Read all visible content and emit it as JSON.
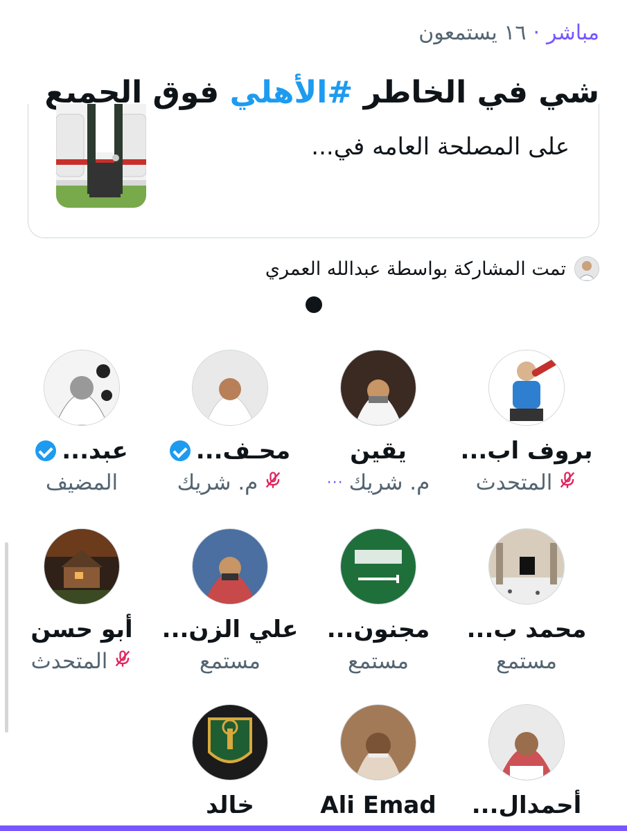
{
  "header": {
    "live_label": "مباشر",
    "separator": "·",
    "listeners": "١٦ يستمعون",
    "title_part1": "شي في الخاطر",
    "title_hashtag": "#الأهلي",
    "title_part2": "فوق الجميع"
  },
  "card": {
    "text": "على المصلحة العامه في..."
  },
  "shared_by": {
    "text": "تمت المشاركة بواسطة عبدالله العمري"
  },
  "participants": [
    {
      "name": "بروف اب...",
      "role": "المتحدث",
      "muted": true,
      "verified": false,
      "avatar_icon": "plumber-avatar"
    },
    {
      "name": "يقين",
      "role": "م. شريك",
      "muted": false,
      "more": "···",
      "verified": false,
      "avatar_icon": "man-shemagh-avatar"
    },
    {
      "name": "محـف...",
      "role": "م. شريك",
      "muted": true,
      "verified": true,
      "avatar_icon": "man-white-ghutra-avatar"
    },
    {
      "name": "عبد...",
      "role": "المضيف",
      "muted": false,
      "verified": true,
      "avatar_icon": "man-bw-avatar"
    },
    {
      "name": "محمد ب...",
      "role": "مستمع",
      "muted": false,
      "verified": false,
      "avatar_icon": "mosque-avatar"
    },
    {
      "name": "مجنون...",
      "role": "مستمع",
      "muted": false,
      "verified": false,
      "avatar_icon": "saudi-flag-avatar"
    },
    {
      "name": "علي الزن...",
      "role": "مستمع",
      "muted": false,
      "verified": false,
      "avatar_icon": "man-red-shemagh-avatar"
    },
    {
      "name": "أبو حسن",
      "role": "المتحدث",
      "muted": true,
      "verified": false,
      "avatar_icon": "cabin-avatar"
    },
    {
      "name": "أحمدال...",
      "role": "",
      "muted": false,
      "verified": false,
      "avatar_icon": "man-red-shemagh-avatar-2"
    },
    {
      "name": "Ali Emad",
      "role": "",
      "muted": false,
      "verified": false,
      "avatar_icon": "mosaic-portrait-avatar"
    },
    {
      "name": "خالد",
      "role": "",
      "muted": false,
      "verified": false,
      "avatar_icon": "alahli-logo-avatar"
    }
  ],
  "colors": {
    "accent": "#7856ff",
    "hashtag": "#1d9bf0",
    "verified": "#1d9bf0",
    "muted_icon": "#e0245e"
  }
}
